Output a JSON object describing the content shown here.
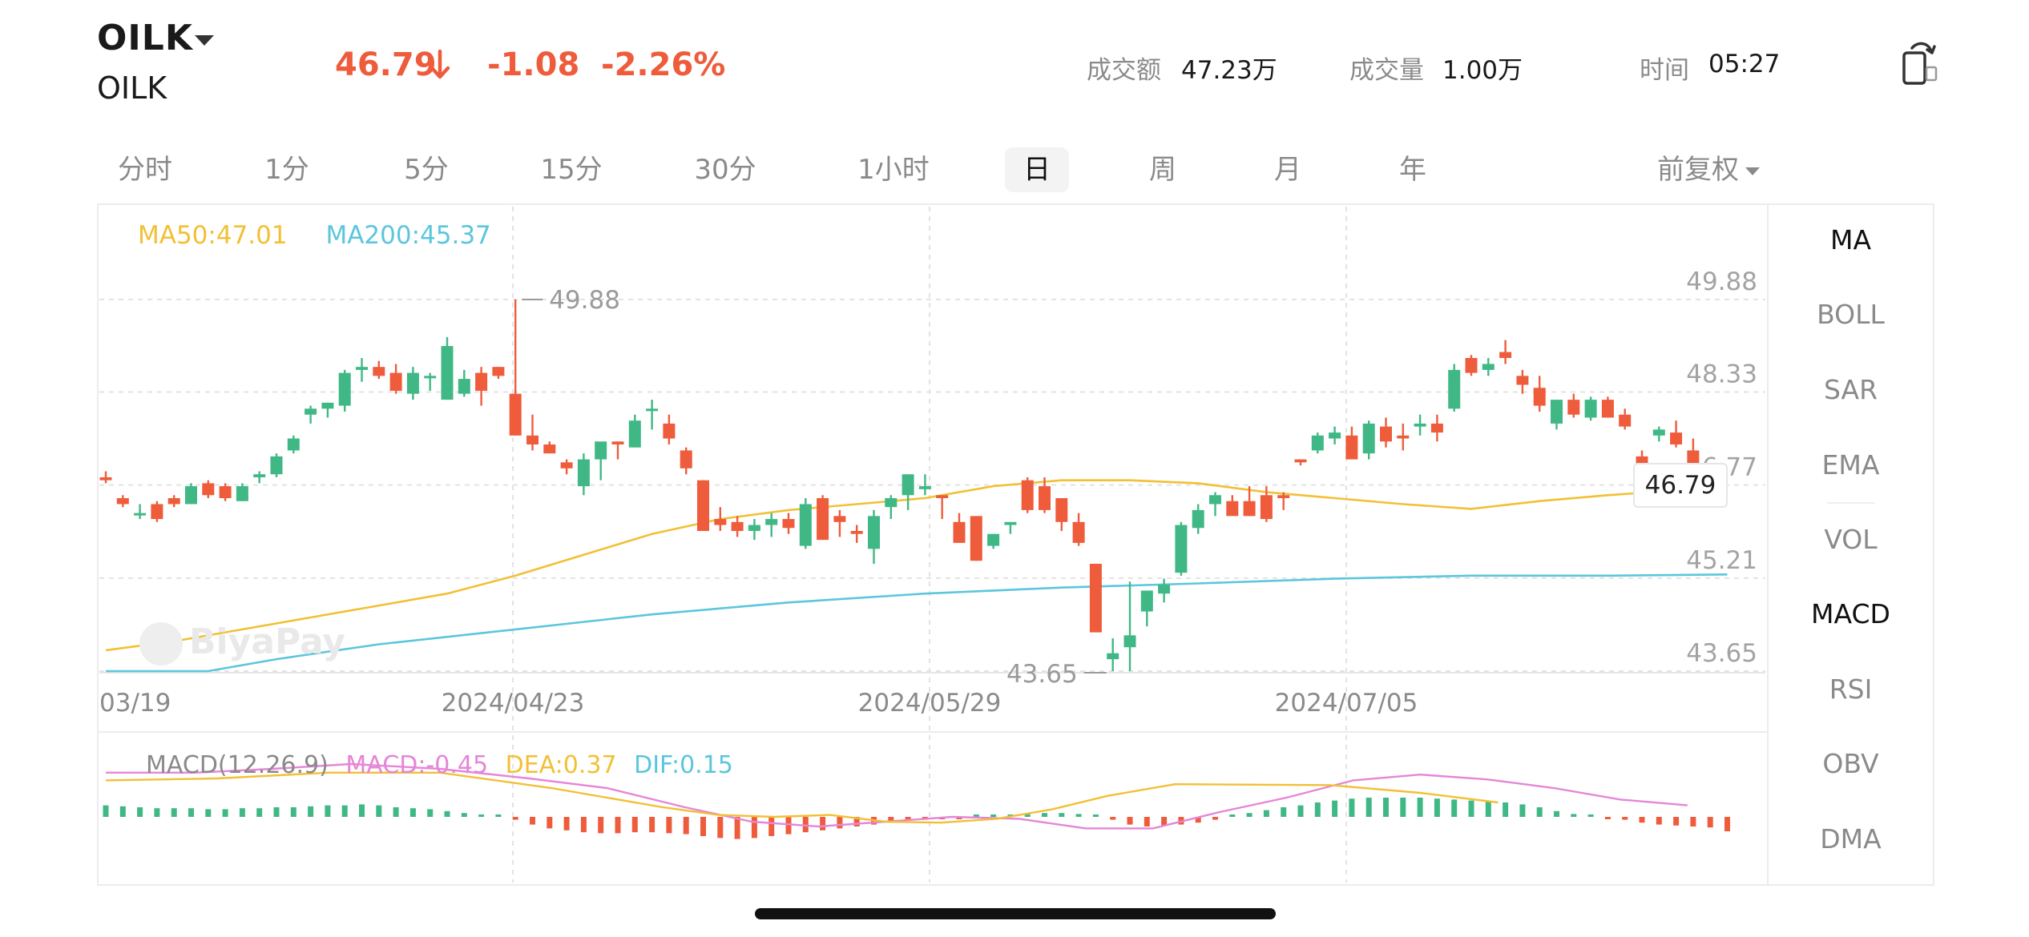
{
  "header": {
    "symbol": "OILK",
    "name": "OILK",
    "price": "46.79",
    "change": "-1.08",
    "change_pct": "-2.26%",
    "turnover_label": "成交额",
    "turnover_value": "47.23万",
    "volume_label": "成交量",
    "volume_value": "1.00万",
    "time_label": "时间",
    "time_value": "05:27",
    "down_color": "#ee5c3c",
    "up_color": "#3fb886"
  },
  "tabs": [
    {
      "label": "分时"
    },
    {
      "label": "1分"
    },
    {
      "label": "5分"
    },
    {
      "label": "15分"
    },
    {
      "label": "30分"
    },
    {
      "label": "1小时"
    },
    {
      "label": "日",
      "active": true
    },
    {
      "label": "周"
    },
    {
      "label": "月"
    },
    {
      "label": "年"
    }
  ],
  "adjust_label": "前复权",
  "indicators": [
    {
      "label": "MA",
      "active": true
    },
    {
      "label": "BOLL"
    },
    {
      "label": "SAR"
    },
    {
      "label": "EMA"
    },
    {
      "label": "VOL"
    },
    {
      "label": "MACD",
      "active": true
    },
    {
      "label": "RSI"
    },
    {
      "label": "OBV"
    },
    {
      "label": "DMA"
    }
  ],
  "ma_legend": {
    "ma50": "MA50:47.01",
    "ma200": "MA200:45.37",
    "ma50_color": "#f2c035",
    "ma200_color": "#5bc6dd"
  },
  "macd_legend": {
    "params": "MACD(12.26.9)",
    "macd": "MACD:-0.45",
    "dea": "DEA:0.37",
    "dif": "DIF:0.15",
    "macd_color": "#e586d8",
    "dea_color": "#f2c035",
    "dif_color": "#5bc6dd"
  },
  "watermark": "BiyaPay",
  "chart_data": {
    "type": "candlestick",
    "y_ticks": [
      "49.88",
      "48.33",
      "46.77",
      "45.21",
      "43.65"
    ],
    "ylim": [
      43.65,
      49.88
    ],
    "x_ticks": [
      "03/19",
      "2024/04/23",
      "2024/05/29",
      "2024/07/05"
    ],
    "last_price_tag": "46.79",
    "high_marker": "49.88",
    "low_marker": "43.65",
    "candles": [
      [
        46.9,
        47.0,
        46.8,
        46.85
      ],
      [
        46.55,
        46.6,
        46.4,
        46.45
      ],
      [
        46.3,
        46.45,
        46.2,
        46.3
      ],
      [
        46.45,
        46.5,
        46.15,
        46.2
      ],
      [
        46.55,
        46.6,
        46.4,
        46.45
      ],
      [
        46.45,
        46.8,
        46.45,
        46.75
      ],
      [
        46.8,
        46.85,
        46.55,
        46.6
      ],
      [
        46.75,
        46.8,
        46.5,
        46.55
      ],
      [
        46.5,
        46.8,
        46.5,
        46.75
      ],
      [
        46.9,
        47.0,
        46.8,
        46.95
      ],
      [
        46.95,
        47.3,
        46.9,
        47.25
      ],
      [
        47.35,
        47.6,
        47.3,
        47.55
      ],
      [
        47.95,
        48.1,
        47.8,
        48.05
      ],
      [
        48.05,
        48.15,
        47.9,
        48.15
      ],
      [
        48.1,
        48.7,
        48.0,
        48.65
      ],
      [
        48.7,
        48.9,
        48.5,
        48.75
      ],
      [
        48.75,
        48.85,
        48.55,
        48.6
      ],
      [
        48.65,
        48.8,
        48.3,
        48.35
      ],
      [
        48.3,
        48.75,
        48.2,
        48.65
      ],
      [
        48.6,
        48.65,
        48.35,
        48.6
      ],
      [
        48.2,
        49.25,
        48.2,
        49.1
      ],
      [
        48.3,
        48.7,
        48.25,
        48.55
      ],
      [
        48.65,
        48.75,
        48.1,
        48.35
      ],
      [
        48.75,
        48.75,
        48.55,
        48.6
      ],
      [
        48.3,
        49.88,
        47.6,
        47.6
      ],
      [
        47.6,
        47.95,
        47.35,
        47.45
      ],
      [
        47.45,
        47.5,
        47.3,
        47.3
      ],
      [
        47.15,
        47.2,
        46.95,
        47.05
      ],
      [
        46.75,
        47.3,
        46.6,
        47.2
      ],
      [
        47.2,
        47.3,
        46.85,
        47.5
      ],
      [
        47.5,
        47.5,
        47.2,
        47.45
      ],
      [
        47.4,
        47.95,
        47.4,
        47.85
      ],
      [
        48.05,
        48.2,
        47.7,
        48.05
      ],
      [
        47.8,
        47.95,
        47.45,
        47.55
      ],
      [
        47.35,
        47.4,
        46.95,
        47.05
      ],
      [
        46.85,
        46.85,
        46.0,
        46.0
      ],
      [
        46.2,
        46.4,
        46.0,
        46.1
      ],
      [
        46.15,
        46.25,
        45.9,
        46.0
      ],
      [
        46.0,
        46.2,
        45.85,
        46.1
      ],
      [
        46.1,
        46.3,
        45.9,
        46.2
      ],
      [
        46.2,
        46.3,
        45.95,
        46.05
      ],
      [
        45.75,
        46.55,
        45.7,
        46.45
      ],
      [
        46.55,
        46.6,
        45.85,
        45.85
      ],
      [
        46.25,
        46.35,
        45.9,
        46.15
      ],
      [
        46.0,
        46.1,
        45.8,
        45.95
      ],
      [
        45.7,
        46.35,
        45.45,
        46.25
      ],
      [
        46.4,
        46.6,
        46.2,
        46.55
      ],
      [
        46.6,
        46.9,
        46.35,
        46.95
      ],
      [
        46.7,
        46.95,
        46.6,
        46.75
      ],
      [
        46.6,
        46.6,
        46.2,
        46.55
      ],
      [
        46.15,
        46.3,
        45.9,
        45.8
      ],
      [
        46.25,
        46.25,
        45.5,
        45.5
      ],
      [
        45.75,
        45.95,
        45.7,
        45.95
      ],
      [
        46.1,
        46.1,
        45.95,
        46.15
      ],
      [
        46.85,
        46.9,
        46.3,
        46.35
      ],
      [
        46.75,
        46.9,
        46.3,
        46.35
      ],
      [
        46.55,
        46.55,
        46.0,
        46.15
      ],
      [
        46.15,
        46.3,
        45.75,
        45.8
      ],
      [
        45.45,
        45.45,
        44.3,
        44.3
      ],
      [
        43.85,
        44.2,
        43.65,
        43.95
      ],
      [
        44.05,
        45.15,
        43.65,
        44.25
      ],
      [
        44.65,
        45.0,
        44.4,
        45.0
      ],
      [
        44.95,
        45.2,
        44.8,
        45.1
      ],
      [
        45.3,
        46.15,
        45.25,
        46.1
      ],
      [
        46.05,
        46.45,
        45.95,
        46.35
      ],
      [
        46.45,
        46.65,
        46.25,
        46.6
      ],
      [
        46.5,
        46.6,
        46.3,
        46.25
      ],
      [
        46.5,
        46.75,
        46.25,
        46.25
      ],
      [
        46.6,
        46.75,
        46.15,
        46.2
      ],
      [
        46.6,
        46.65,
        46.35,
        46.55
      ],
      [
        47.2,
        47.2,
        47.1,
        47.15
      ],
      [
        47.35,
        47.65,
        47.3,
        47.6
      ],
      [
        47.55,
        47.75,
        47.45,
        47.65
      ],
      [
        47.6,
        47.75,
        47.4,
        47.2
      ],
      [
        47.3,
        47.85,
        47.2,
        47.8
      ],
      [
        47.75,
        47.9,
        47.4,
        47.5
      ],
      [
        47.6,
        47.8,
        47.35,
        47.55
      ],
      [
        47.75,
        47.95,
        47.6,
        47.8
      ],
      [
        47.8,
        47.95,
        47.5,
        47.65
      ],
      [
        48.05,
        48.8,
        48.0,
        48.7
      ],
      [
        48.9,
        48.95,
        48.6,
        48.65
      ],
      [
        48.7,
        48.9,
        48.6,
        48.8
      ],
      [
        49.0,
        49.2,
        48.8,
        48.9
      ],
      [
        48.6,
        48.7,
        48.3,
        48.45
      ],
      [
        48.4,
        48.6,
        48.0,
        48.1
      ],
      [
        47.8,
        48.2,
        47.7,
        48.2
      ],
      [
        48.2,
        48.3,
        47.9,
        47.95
      ],
      [
        47.9,
        48.25,
        47.85,
        48.2
      ],
      [
        48.2,
        48.25,
        47.9,
        47.9
      ],
      [
        47.95,
        48.05,
        47.7,
        47.75
      ],
      [
        47.25,
        47.35,
        47.05,
        47.1
      ],
      [
        47.6,
        47.75,
        47.5,
        47.7
      ],
      [
        47.65,
        47.85,
        47.4,
        47.45
      ],
      [
        47.35,
        47.55,
        46.75,
        46.79
      ]
    ],
    "ma50": [
      [
        0,
        44.0
      ],
      [
        4,
        44.15
      ],
      [
        8,
        44.35
      ],
      [
        12,
        44.55
      ],
      [
        16,
        44.75
      ],
      [
        20,
        44.95
      ],
      [
        24,
        45.25
      ],
      [
        28,
        45.6
      ],
      [
        32,
        45.95
      ],
      [
        36,
        46.2
      ],
      [
        40,
        46.35
      ],
      [
        44,
        46.45
      ],
      [
        48,
        46.55
      ],
      [
        52,
        46.75
      ],
      [
        56,
        46.85
      ],
      [
        60,
        46.85
      ],
      [
        64,
        46.8
      ],
      [
        68,
        46.65
      ],
      [
        72,
        46.55
      ],
      [
        76,
        46.45
      ],
      [
        80,
        46.37
      ],
      [
        84,
        46.5
      ],
      [
        88,
        46.6
      ],
      [
        92,
        46.68
      ],
      [
        95,
        46.72
      ]
    ],
    "ma200": [
      [
        0,
        43.65
      ],
      [
        6,
        43.65
      ],
      [
        10,
        43.85
      ],
      [
        16,
        44.1
      ],
      [
        24,
        44.35
      ],
      [
        32,
        44.6
      ],
      [
        40,
        44.8
      ],
      [
        48,
        44.95
      ],
      [
        56,
        45.05
      ],
      [
        64,
        45.12
      ],
      [
        72,
        45.2
      ],
      [
        80,
        45.25
      ],
      [
        88,
        45.25
      ],
      [
        95,
        45.27
      ]
    ],
    "macd_hist": [
      0.12,
      0.11,
      0.1,
      0.09,
      0.09,
      0.09,
      0.08,
      0.08,
      0.09,
      0.09,
      0.1,
      0.1,
      0.11,
      0.12,
      0.12,
      0.13,
      0.12,
      0.1,
      0.09,
      0.08,
      0.06,
      0.04,
      0.02,
      0.0,
      -0.03,
      -0.08,
      -0.12,
      -0.14,
      -0.16,
      -0.17,
      -0.17,
      -0.16,
      -0.16,
      -0.17,
      -0.18,
      -0.2,
      -0.22,
      -0.23,
      -0.22,
      -0.2,
      -0.18,
      -0.16,
      -0.14,
      -0.12,
      -0.1,
      -0.08,
      -0.06,
      -0.04,
      -0.03,
      -0.02,
      -0.01,
      0.0,
      0.01,
      0.02,
      0.03,
      0.04,
      0.04,
      0.03,
      0.01,
      -0.03,
      -0.08,
      -0.1,
      -0.09,
      -0.08,
      -0.06,
      -0.03,
      0.0,
      0.04,
      0.07,
      0.1,
      0.12,
      0.15,
      0.17,
      0.19,
      0.2,
      0.2,
      0.2,
      0.2,
      0.19,
      0.18,
      0.17,
      0.16,
      0.15,
      0.13,
      0.1,
      0.06,
      0.03,
      0.01,
      -0.01,
      -0.03,
      -0.06,
      -0.08,
      -0.09,
      -0.1,
      -0.11,
      -0.15
    ],
    "dea": [
      [
        0,
        0.38
      ],
      [
        10,
        0.4
      ],
      [
        20,
        0.46
      ],
      [
        30,
        0.46
      ],
      [
        40,
        0.3
      ],
      [
        50,
        0.1
      ],
      [
        55,
        0.02
      ],
      [
        60,
        0.0
      ],
      [
        65,
        0.02
      ],
      [
        70,
        -0.05
      ],
      [
        75,
        -0.06
      ],
      [
        80,
        -0.02
      ],
      [
        85,
        0.08
      ],
      [
        90,
        0.22
      ],
      [
        96,
        0.34
      ],
      [
        110,
        0.33
      ],
      [
        118,
        0.25
      ],
      [
        125,
        0.15
      ]
    ],
    "macd_line": [
      [
        0,
        0.46
      ],
      [
        8,
        0.46
      ],
      [
        15,
        0.5
      ],
      [
        22,
        0.55
      ],
      [
        30,
        0.5
      ],
      [
        38,
        0.4
      ],
      [
        45,
        0.3
      ],
      [
        52,
        0.1
      ],
      [
        58,
        -0.05
      ],
      [
        64,
        -0.1
      ],
      [
        70,
        -0.05
      ],
      [
        76,
        0.0
      ],
      [
        82,
        -0.02
      ],
      [
        88,
        -0.12
      ],
      [
        94,
        -0.12
      ],
      [
        100,
        0.05
      ],
      [
        106,
        0.2
      ],
      [
        112,
        0.38
      ],
      [
        118,
        0.44
      ],
      [
        124,
        0.39
      ],
      [
        130,
        0.3
      ],
      [
        136,
        0.18
      ],
      [
        142,
        0.12
      ]
    ]
  }
}
